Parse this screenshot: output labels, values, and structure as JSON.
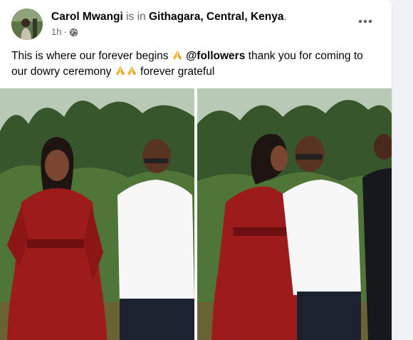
{
  "post": {
    "author": "Carol Mwangi",
    "is_in": "is in",
    "location": "Githagara, Central, Kenya",
    "location_end": ".",
    "time": "1h",
    "separator": "·",
    "privacy_icon": "globe-icon",
    "more_icon": "more-horizontal-icon",
    "caption": {
      "part1": "This is where our forever begins",
      "mention": "@followers",
      "part2": "thank you for coming to our dowry ceremony",
      "part3": "forever grateful",
      "emoji": "folded-hands-emoji"
    },
    "photos": [
      {
        "name": "photo-couple-left",
        "description_icon": "image"
      },
      {
        "name": "photo-couple-right",
        "description_icon": "image"
      }
    ]
  },
  "colors": {
    "background": "#f0f2f5",
    "card": "#ffffff",
    "text": "#050505",
    "secondary_text": "#65676b",
    "dress_red": "#9e1b1b",
    "shirt_white": "#f7f7f7"
  }
}
